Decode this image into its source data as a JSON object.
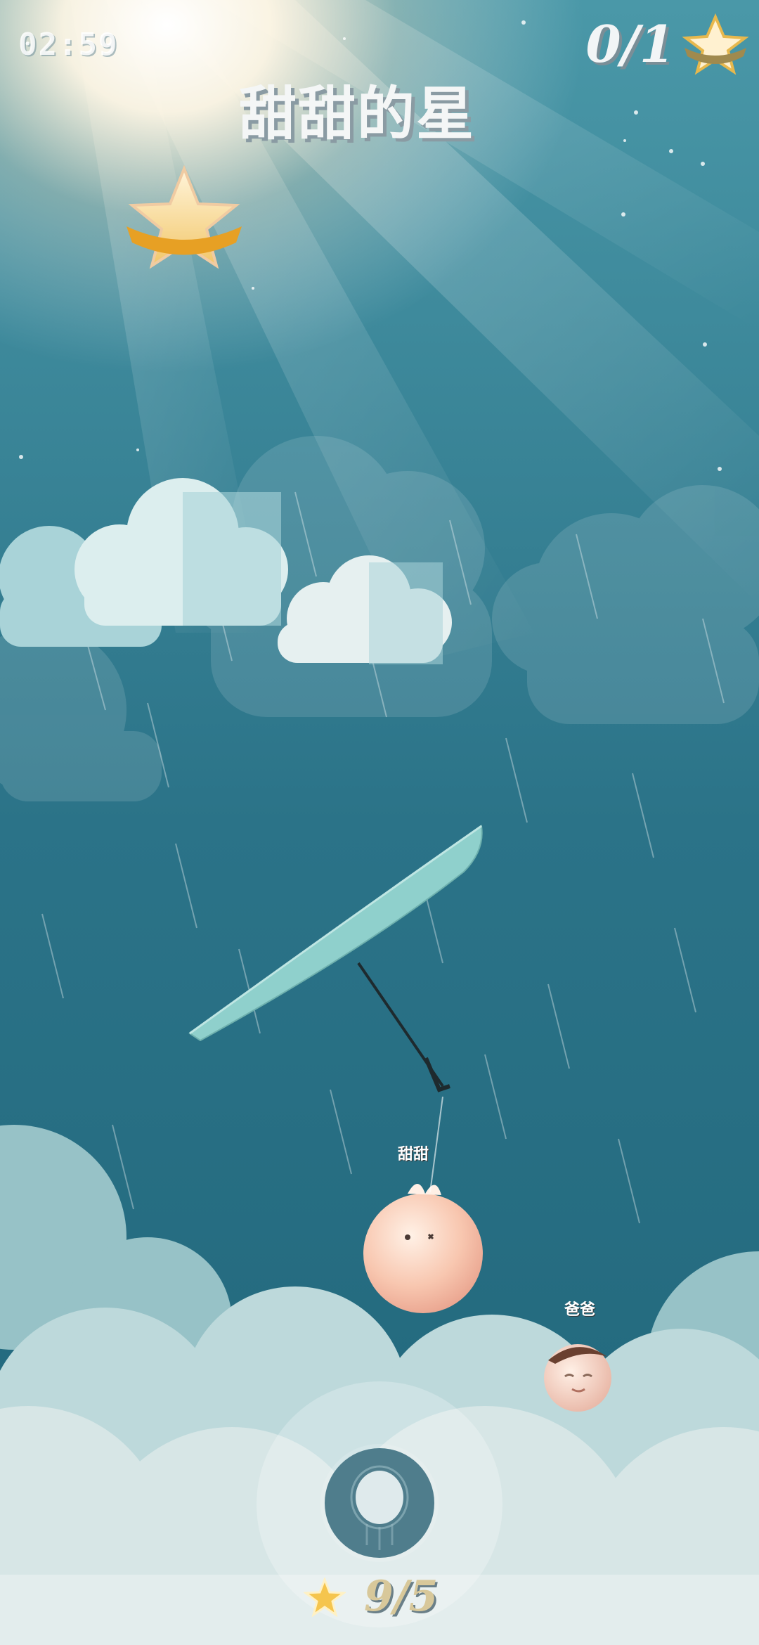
{
  "hud": {
    "timer": "02:59",
    "stars_collected": "0/1",
    "level_title": "甜甜的星"
  },
  "characters": {
    "tiantian_label": "甜甜",
    "baba_label": "爸爸"
  },
  "bottom": {
    "moves_text": "9/5"
  },
  "colors": {
    "sky_top": "#3f8ea0",
    "sky_bottom": "#1f5f73",
    "cloud_light": "#e6f0f0",
    "cloud_mid": "#a9cfd4",
    "umbrella": "#8fd0cc",
    "star_gold": "#f4c04a"
  },
  "icons": [
    "star-icon",
    "umbrella-icon",
    "drop-button-icon"
  ]
}
